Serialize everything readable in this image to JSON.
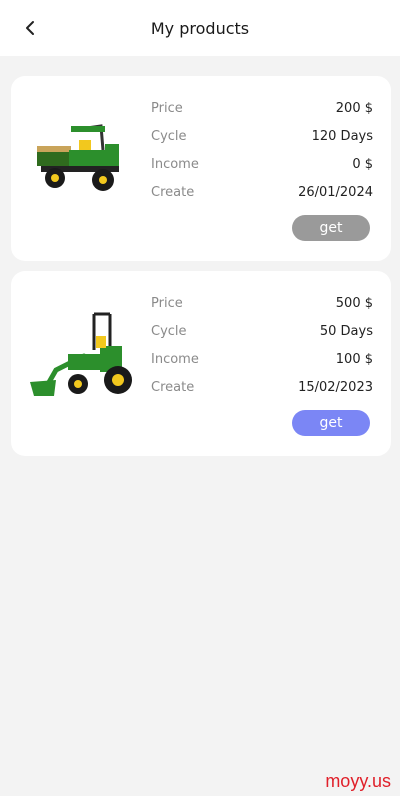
{
  "header": {
    "title": "My products",
    "back_icon": "back-arrow-icon"
  },
  "products": [
    {
      "image": "utility-vehicle-image",
      "rows": [
        {
          "label": "Price",
          "value": "200 $"
        },
        {
          "label": "Cycle",
          "value": "120 Days"
        },
        {
          "label": "Income",
          "value": "0 $"
        },
        {
          "label": "Create",
          "value": "26/01/2024"
        }
      ],
      "button_label": "get",
      "button_color": "#9a9a9a"
    },
    {
      "image": "compact-tractor-image",
      "rows": [
        {
          "label": "Price",
          "value": "500 $"
        },
        {
          "label": "Cycle",
          "value": "50 Days"
        },
        {
          "label": "Income",
          "value": "100 $"
        },
        {
          "label": "Create",
          "value": "15/02/2023"
        }
      ],
      "button_label": "get",
      "button_color": "#7b86f5"
    }
  ],
  "watermark": "moyy.us",
  "colors": {
    "background": "#f3f3f3",
    "card": "#ffffff",
    "watermark": "#e0202a"
  }
}
